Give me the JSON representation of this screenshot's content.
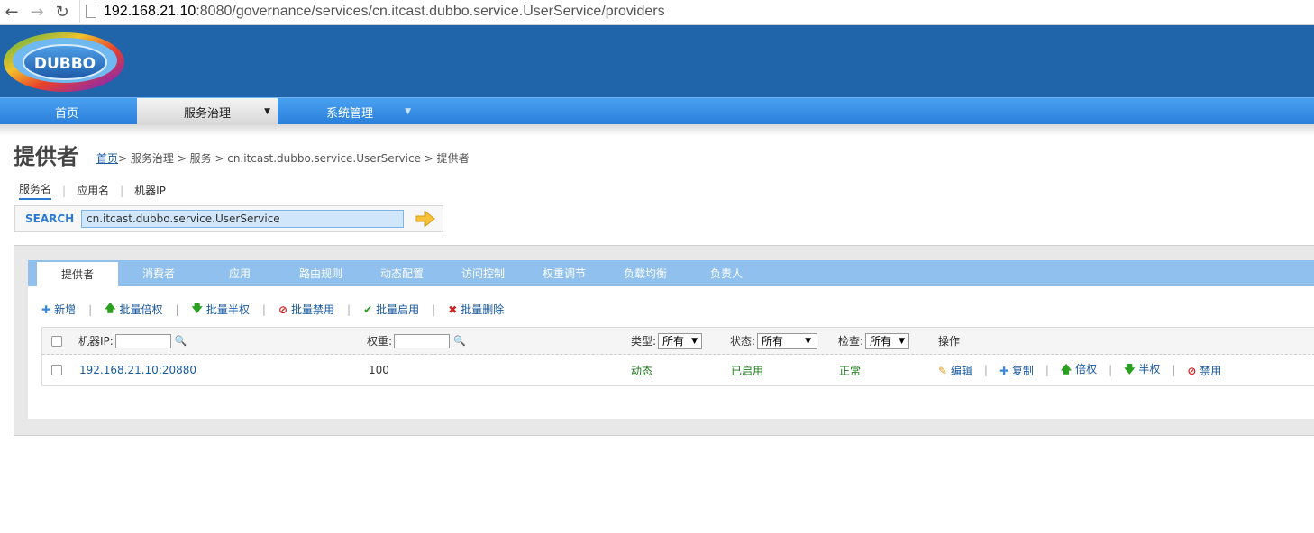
{
  "browser": {
    "url_host": "192.168.21.10",
    "url_rest": ":8080/governance/services/cn.itcast.dubbo.service.UserService/providers"
  },
  "logo": {
    "text": "DUBBO"
  },
  "mainnav": {
    "items": [
      {
        "label": "首页"
      },
      {
        "label": "服务治理"
      },
      {
        "label": "系统管理"
      }
    ]
  },
  "page": {
    "title": "提供者",
    "breadcrumb": {
      "home": "首页",
      "rest": " > 服务治理 > 服务 > cn.itcast.dubbo.service.UserService > 提供者"
    }
  },
  "search": {
    "tabs": [
      {
        "label": "服务名"
      },
      {
        "label": "应用名"
      },
      {
        "label": "机器IP"
      }
    ],
    "label": "SEARCH",
    "value": "cn.itcast.dubbo.service.UserService"
  },
  "tabs": [
    {
      "label": "提供者"
    },
    {
      "label": "消费者"
    },
    {
      "label": "应用"
    },
    {
      "label": "路由规则"
    },
    {
      "label": "动态配置"
    },
    {
      "label": "访问控制"
    },
    {
      "label": "权重调节"
    },
    {
      "label": "负载均衡"
    },
    {
      "label": "负责人"
    }
  ],
  "actions": {
    "add": "新增",
    "batch_double": "批量倍权",
    "batch_half": "批量半权",
    "batch_disable": "批量禁用",
    "batch_enable": "批量启用",
    "batch_delete": "批量删除"
  },
  "table": {
    "headers": {
      "ip": "机器IP:",
      "weight": "权重:",
      "type": "类型:",
      "type_value": "所有",
      "status": "状态:",
      "status_value": "所有",
      "check": "检查:",
      "check_value": "所有",
      "ops": "操作"
    },
    "rows": [
      {
        "ip": "192.168.21.10:20880",
        "weight": "100",
        "type": "动态",
        "status": "已启用",
        "check": "正常",
        "ops": {
          "edit": "编辑",
          "copy": "复制",
          "double": "倍权",
          "half": "半权",
          "disable": "禁用"
        }
      }
    ]
  },
  "colors": {
    "banner": "#2064aa",
    "nav": "#2a80db",
    "tabbar": "#8fc0ee",
    "link": "#1a5aa0"
  }
}
